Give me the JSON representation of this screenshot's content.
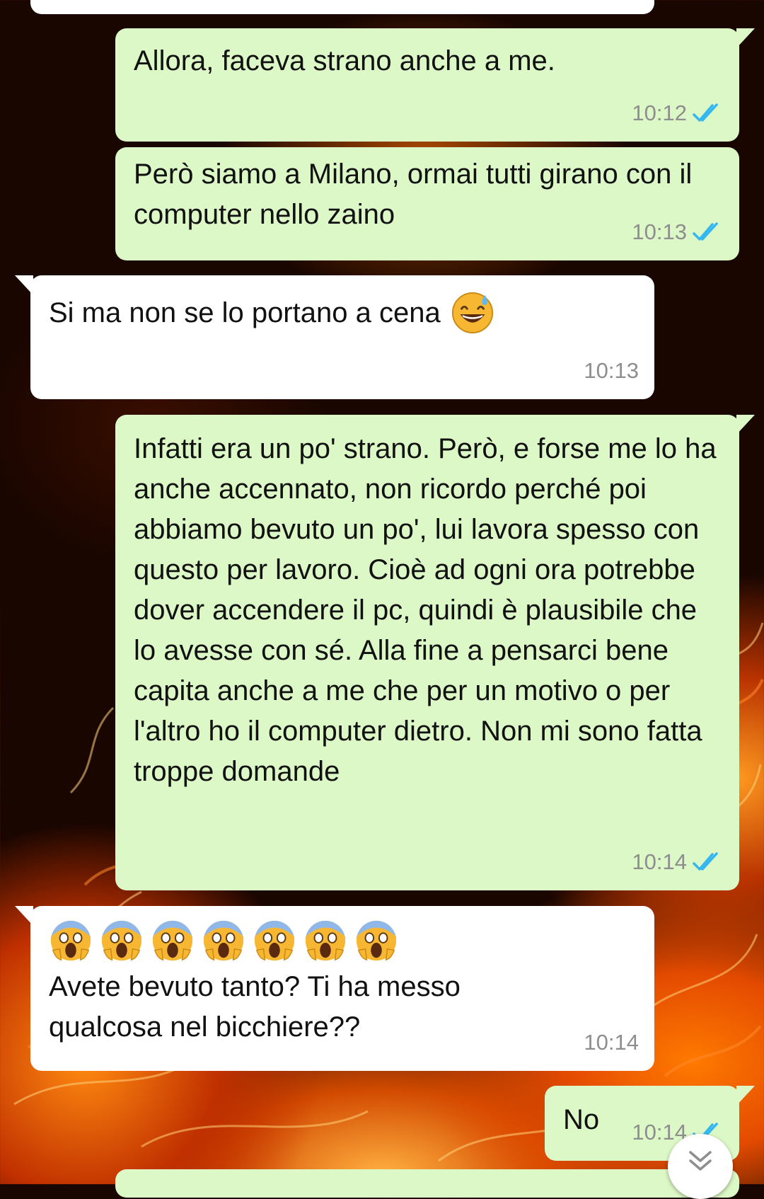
{
  "messages": [
    {
      "text": "",
      "time": ""
    },
    {
      "text": "Allora, faceva strano anche a me.",
      "time": "10:12"
    },
    {
      "text": "Però siamo a Milano, ormai tutti girano con il computer nello zaino",
      "time": "10:13"
    },
    {
      "text": "Si ma non se lo portano a cena",
      "time": "10:13",
      "emoji": "grinning-sweat-emoji"
    },
    {
      "text": "Infatti era un po' strano. Però, e forse me lo ha anche accennato, non ricordo perché poi abbiamo bevuto un po', lui lavora spesso con questo per lavoro. Cioè ad ogni ora potrebbe dover accendere il pc, quindi è plausibile che lo avesse con sé. Alla fine a pensarci bene capita anche a me che per un motivo o per l'altro ho il computer dietro. Non mi sono fatta troppe domande",
      "time": "10:14"
    },
    {
      "text": "Avete bevuto tanto? Ti ha messo qualcosa nel bicchiere??",
      "time": "10:14",
      "emoji": "screaming-face-emoji",
      "emoji_count": 7
    },
    {
      "text": "No",
      "time": "10:14"
    }
  ],
  "colors": {
    "outgoing_bubble": "#dcf8c6",
    "incoming_bubble": "#ffffff",
    "timestamp": "#8e8e8e",
    "read_ticks": "#34b7f1"
  },
  "icons": {
    "read_receipt": "double-check-icon",
    "scroll_down": "double-chevron-down-icon"
  }
}
